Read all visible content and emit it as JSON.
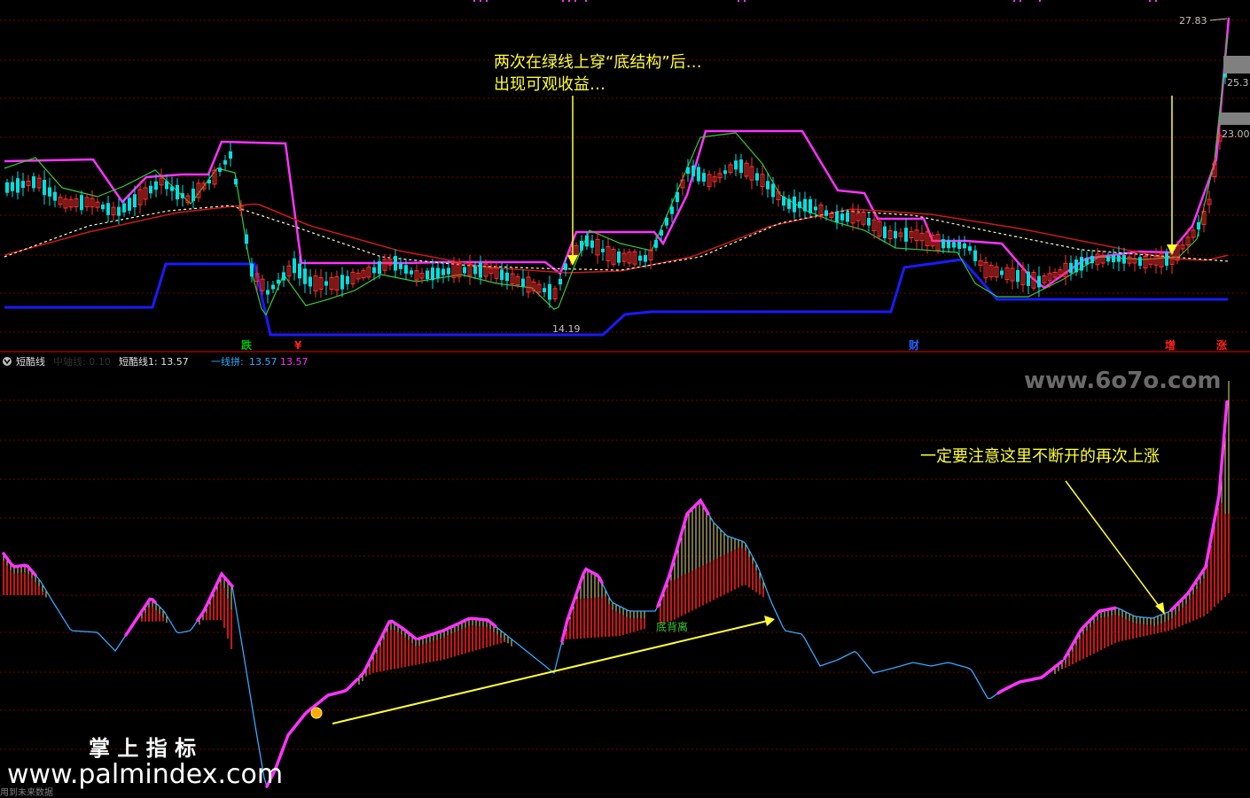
{
  "upper_panel": {
    "price_labels": {
      "high": "27.83",
      "mid": "25.3",
      "low_axis": "23.00",
      "low_mark": "14.19"
    },
    "annotation_line1": "两次在绿线上穿“底结构”后…",
    "annotation_line2": "出现可观收益…",
    "signals": [
      {
        "text": "跌",
        "color": "#00c000"
      },
      {
        "text": "¥",
        "color": "#ff2020"
      },
      {
        "text": "财",
        "color": "#2060ff"
      },
      {
        "text": "增",
        "color": "#ff2020"
      },
      {
        "text": "涨",
        "color": "#ff2020"
      }
    ]
  },
  "lower_panel": {
    "indicator_name": "短酷线",
    "legend_dim": "中轴线: 0.10",
    "legend_1": "短酷线1: 13.57",
    "legend_2_label": "一线拼:",
    "legend_2_val1": "13.57",
    "legend_2_val2": "13.57",
    "annotation_right": "一定要注意这里不断开的再次上涨",
    "annotation_divergence": "底背离",
    "watermark_site": "www.6o7o.com",
    "brand_cn": "掌 上 指 标",
    "brand_url": "www.palmindex.com",
    "footer": "用到未来数据"
  },
  "colors": {
    "background": "#000000",
    "grid": "#7a0000",
    "up_candle": "#ff3030",
    "down_candle": "#00e0e0",
    "magenta": "#ff33ff",
    "green_line": "#33cc33",
    "blue_line": "#1a1aff",
    "red_ma": "#cc1a1a",
    "yellow": "#ffff33",
    "cyan_line": "#33aaff"
  }
}
